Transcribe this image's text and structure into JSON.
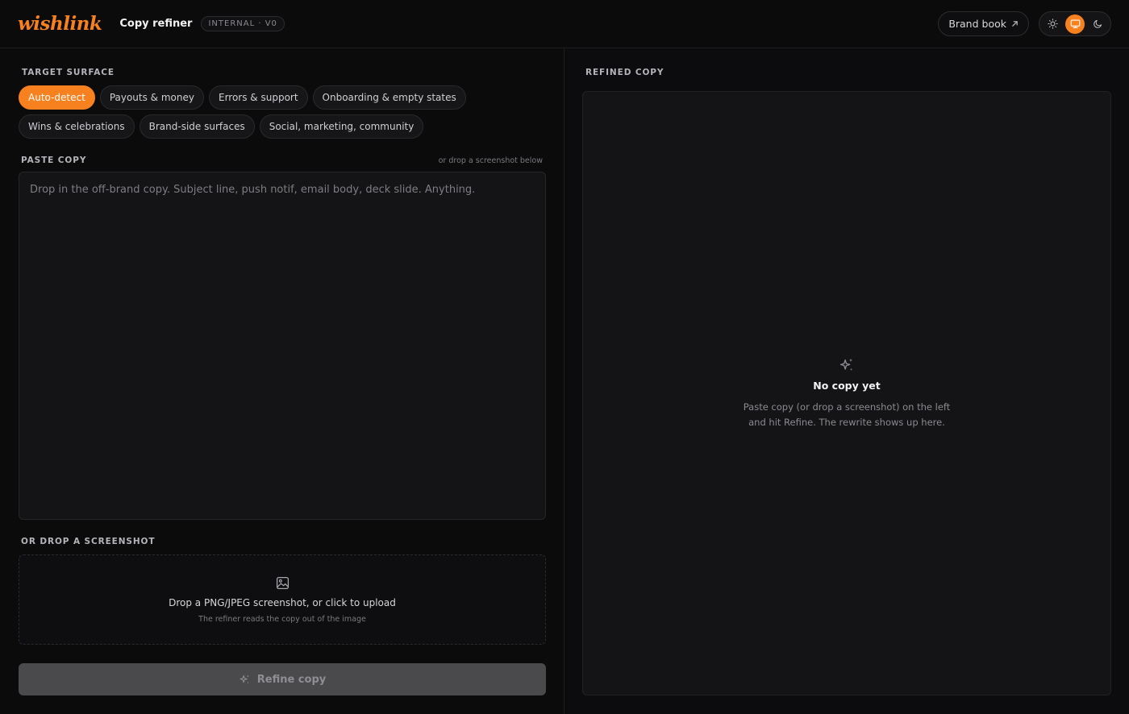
{
  "header": {
    "logo": "wishlink",
    "app_title": "Copy refiner",
    "version_badge": "INTERNAL · V0",
    "brand_book_label": "Brand book",
    "brand_book_icon": "arrow-up-right-icon",
    "theme_options": [
      {
        "name": "light",
        "icon": "sun-icon",
        "active": false
      },
      {
        "name": "system",
        "icon": "monitor-icon",
        "active": true
      },
      {
        "name": "dark",
        "icon": "moon-icon",
        "active": false
      }
    ]
  },
  "left": {
    "target_surface_label": "TARGET SURFACE",
    "surfaces": [
      {
        "label": "Auto-detect",
        "active": true
      },
      {
        "label": "Payouts & money",
        "active": false
      },
      {
        "label": "Errors & support",
        "active": false
      },
      {
        "label": "Onboarding & empty states",
        "active": false
      },
      {
        "label": "Wins & celebrations",
        "active": false
      },
      {
        "label": "Brand-side surfaces",
        "active": false
      },
      {
        "label": "Social, marketing, community",
        "active": false
      }
    ],
    "paste_label": "PASTE COPY",
    "paste_hint": "or drop a screenshot below",
    "paste_placeholder": "Drop in the off-brand copy. Subject line, push notif, email body, deck slide. Anything.",
    "paste_value": "",
    "screenshot_label": "OR DROP A SCREENSHOT",
    "dropzone_title": "Drop a PNG/JPEG screenshot, or click to upload",
    "dropzone_sub": "The refiner reads the copy out of the image",
    "refine_label": "Refine copy"
  },
  "right": {
    "label": "REFINED COPY",
    "empty_title": "No copy yet",
    "empty_desc_line1": "Paste copy (or drop a screenshot) on the left",
    "empty_desc_line2": "and hit Refine. The rewrite shows up here."
  },
  "colors": {
    "accent": "#f7801f",
    "background": "#0b0b0c",
    "panel": "#141416",
    "disabled_button": "#4a4a4d"
  }
}
